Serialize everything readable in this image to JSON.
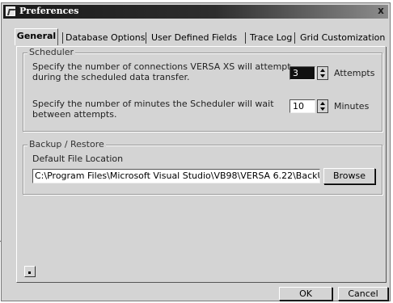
{
  "window": {
    "title": "Preferences",
    "close_label": "x"
  },
  "tabs": [
    {
      "label": "General"
    },
    {
      "label": "Database Options"
    },
    {
      "label": "User Defined Fields"
    },
    {
      "label": "Trace Log"
    },
    {
      "label": "Grid Customization"
    }
  ],
  "scheduler": {
    "legend": "Scheduler",
    "connections_label_line1": "Specify the number of connections VERSA XS will attempt",
    "connections_label_line2": "during the scheduled data  transfer.",
    "connections_value": "3",
    "connections_unit": "Attempts",
    "minutes_label_line1": "Specify the number of minutes the Scheduler will wait",
    "minutes_label_line2": "between attempts.",
    "minutes_value": "10",
    "minutes_unit": "Minutes"
  },
  "backup": {
    "legend": "Backup / Restore",
    "file_location_label": "Default File Location",
    "file_location_value": "C:\\Program Files\\Microsoft Visual Studio\\VB98\\VERSA 6.22\\BackU",
    "browse_label": "Browse"
  },
  "footer": {
    "ok_label": "OK",
    "cancel_label": "Cancel"
  }
}
